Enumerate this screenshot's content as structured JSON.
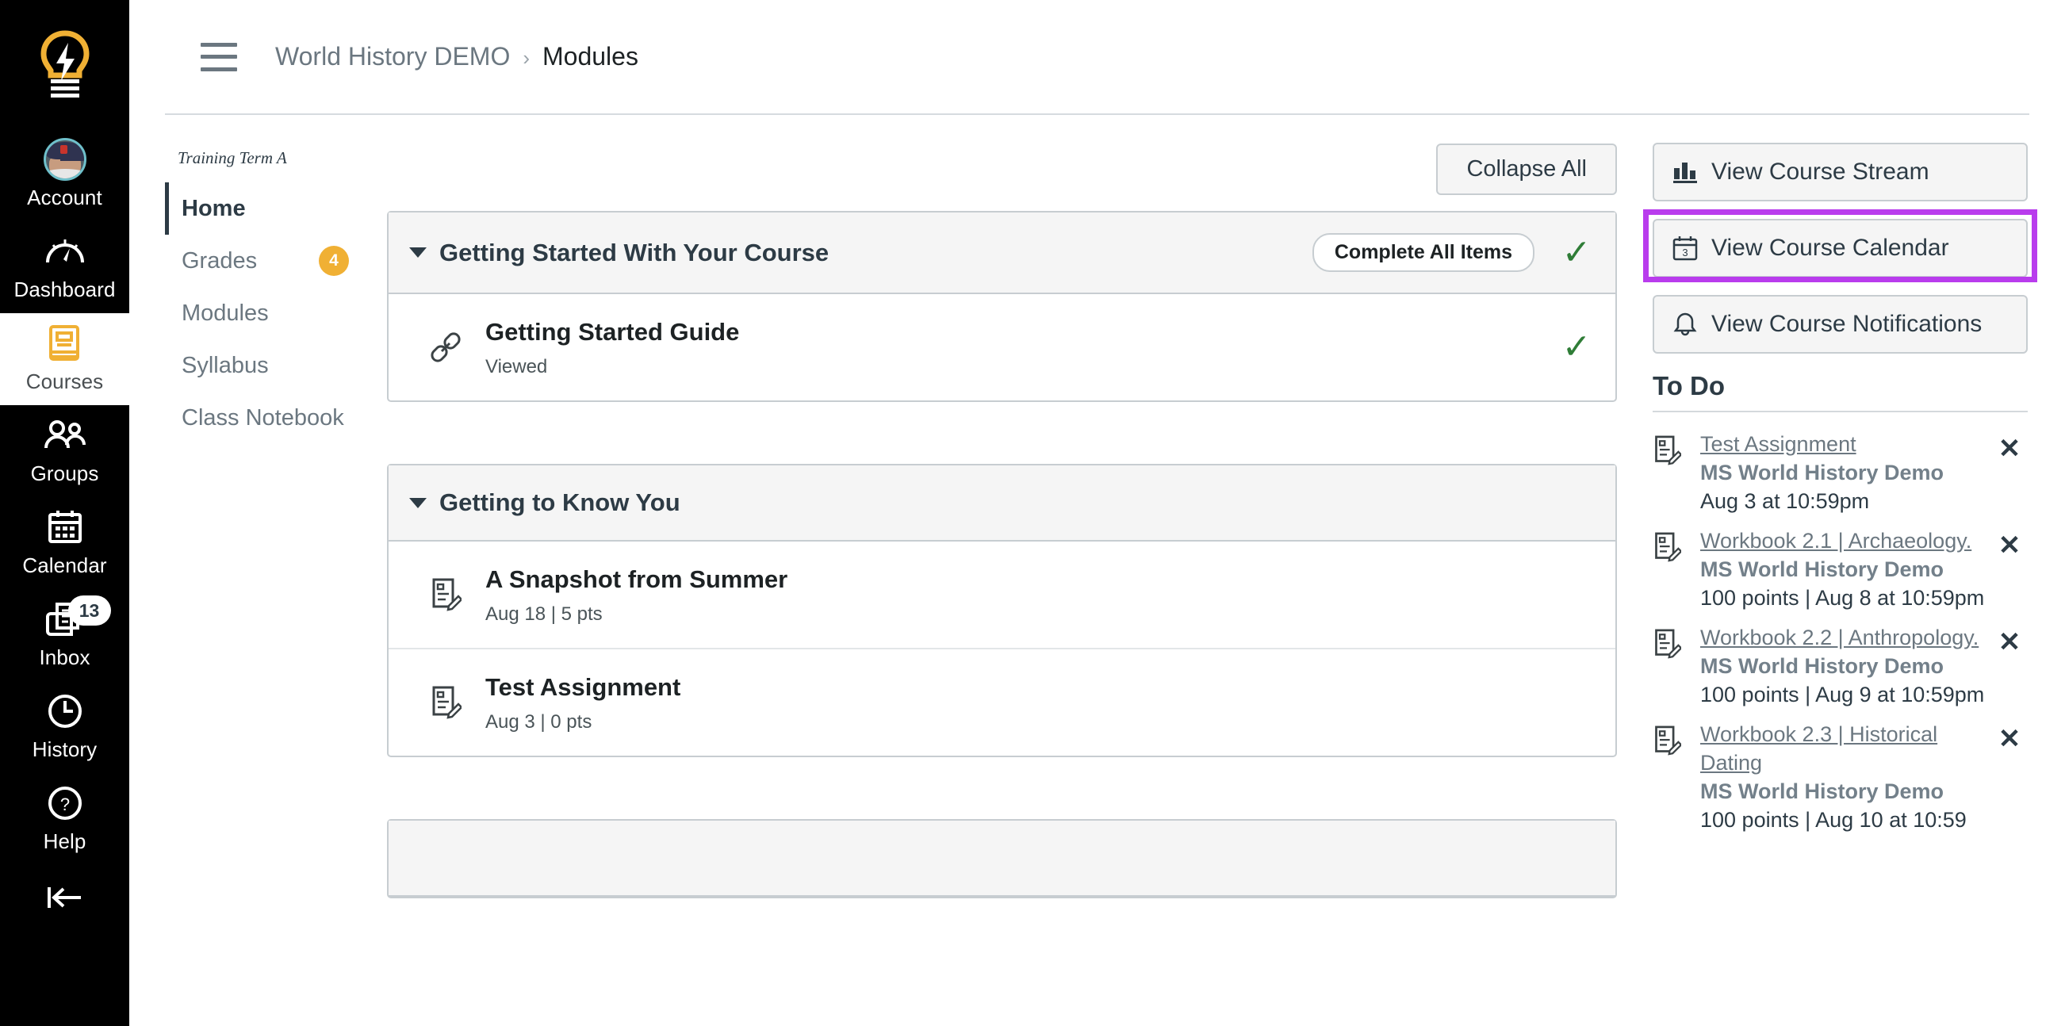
{
  "global_nav": {
    "logo_icon": "lightbulb-logo-icon",
    "items": [
      {
        "label": "Account",
        "icon": "avatar-icon",
        "active": false,
        "badge": null
      },
      {
        "label": "Dashboard",
        "icon": "dashboard-icon",
        "active": false,
        "badge": null
      },
      {
        "label": "Courses",
        "icon": "book-icon",
        "active": true,
        "badge": null
      },
      {
        "label": "Groups",
        "icon": "group-icon",
        "active": false,
        "badge": null
      },
      {
        "label": "Calendar",
        "icon": "calendar-icon",
        "active": false,
        "badge": null
      },
      {
        "label": "Inbox",
        "icon": "inbox-icon",
        "active": false,
        "badge": "13"
      },
      {
        "label": "History",
        "icon": "clock-icon",
        "active": false,
        "badge": null
      },
      {
        "label": "Help",
        "icon": "question-circle-icon",
        "active": false,
        "badge": null
      }
    ],
    "collapse_icon": "collapse-left-arrow-icon"
  },
  "header": {
    "menu_icon": "hamburger-menu-icon",
    "breadcrumb_course": "World History DEMO",
    "breadcrumb_separator": "›",
    "breadcrumb_current": "Modules"
  },
  "course_nav": {
    "term": "Training Term A",
    "items": [
      {
        "label": "Home",
        "active": true,
        "pill": null
      },
      {
        "label": "Grades",
        "active": false,
        "pill": "4"
      },
      {
        "label": "Modules",
        "active": false,
        "pill": null
      },
      {
        "label": "Syllabus",
        "active": false,
        "pill": null
      },
      {
        "label": "Class Notebook",
        "active": false,
        "pill": null
      }
    ]
  },
  "content": {
    "collapse_all_label": "Collapse All",
    "modules": [
      {
        "title": "Getting Started With Your Course",
        "requirement_pill": "Complete All Items",
        "completed": true,
        "items": [
          {
            "title": "Getting Started Guide",
            "sub": "Viewed",
            "icon": "link-icon",
            "completed": true
          }
        ]
      },
      {
        "title": "Getting to Know You",
        "requirement_pill": null,
        "completed": false,
        "items": [
          {
            "title": "A Snapshot from Summer",
            "sub": "Aug 18  |  5 pts",
            "icon": "assignment-icon",
            "completed": false
          },
          {
            "title": "Test Assignment",
            "sub": "Aug 3  |  0 pts",
            "icon": "assignment-icon",
            "completed": false
          }
        ]
      }
    ]
  },
  "right_sidebar": {
    "buttons": [
      {
        "label": "View Course Stream",
        "icon": "bar-chart-icon",
        "highlighted": false
      },
      {
        "label": "View Course Calendar",
        "icon": "calendar-icon",
        "highlighted": true
      },
      {
        "label": "View Course Notifications",
        "icon": "bell-icon",
        "highlighted": false
      }
    ],
    "todo_heading": "To Do",
    "todo_items": [
      {
        "icon": "assignment-icon",
        "link": "Test Assignment",
        "course": "MS World History Demo",
        "meta": "Aug 3 at 10:59pm",
        "dismiss_icon": "close-icon"
      },
      {
        "icon": "assignment-icon",
        "link": "Workbook 2.1 | Archaeology.",
        "course": "MS World History Demo",
        "meta": "100 points  |  Aug 8 at 10:59pm",
        "dismiss_icon": "close-icon"
      },
      {
        "icon": "assignment-icon",
        "link": "Workbook 2.2 | Anthropology.",
        "course": "MS World History Demo",
        "meta": "100 points  |  Aug 9 at 10:59pm",
        "dismiss_icon": "close-icon"
      },
      {
        "icon": "assignment-icon",
        "link": "Workbook 2.3 | Historical Dating",
        "course": "MS World History Demo",
        "meta": "100 points  |  Aug 10 at 10:59",
        "dismiss_icon": "close-icon"
      }
    ]
  },
  "colors": {
    "highlight_purple": "#b93ced",
    "brand_yellow": "#f0b034",
    "complete_green": "#2f7d37",
    "nav_black": "#000000",
    "text_dark": "#2d3b45"
  }
}
